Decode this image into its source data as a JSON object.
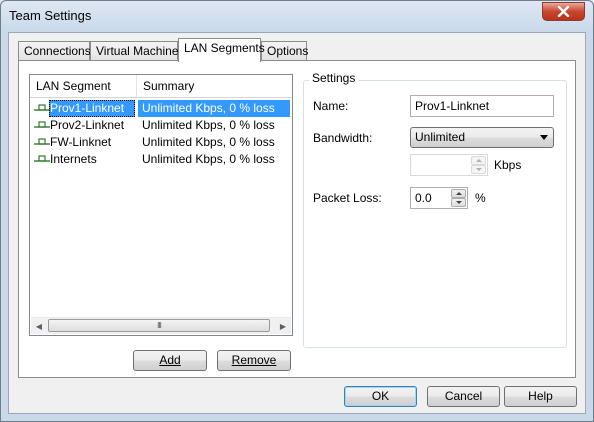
{
  "window": {
    "title": "Team Settings"
  },
  "tabs": [
    {
      "label": "Connections"
    },
    {
      "label": "Virtual Machines"
    },
    {
      "label": "LAN Segments"
    },
    {
      "label": "Options"
    }
  ],
  "list": {
    "columns": [
      "LAN Segment",
      "Summary"
    ],
    "rows": [
      {
        "segment": "Prov1-Linknet",
        "summary": "Unlimited Kbps, 0 % loss"
      },
      {
        "segment": "Prov2-Linknet",
        "summary": "Unlimited Kbps, 0 % loss"
      },
      {
        "segment": "FW-Linknet",
        "summary": "Unlimited Kbps, 0 % loss"
      },
      {
        "segment": "Internets",
        "summary": "Unlimited Kbps, 0 % loss"
      }
    ],
    "scroll_thumb": "III"
  },
  "buttons": {
    "add": "Add",
    "remove": "Remove",
    "ok": "OK",
    "cancel": "Cancel",
    "help": "Help"
  },
  "settings": {
    "group_title": "Settings",
    "name_label": "Name:",
    "name_value": "Prov1-Linknet",
    "bandwidth_label": "Bandwidth:",
    "bandwidth_value": "Unlimited",
    "kbps_value": "",
    "kbps_unit": "Kbps",
    "packet_loss_label": "Packet Loss:",
    "packet_loss_value": "0.0",
    "percent_unit": "%"
  },
  "colors": {
    "selection": "#3399ff",
    "close_button": "#c7462f"
  }
}
